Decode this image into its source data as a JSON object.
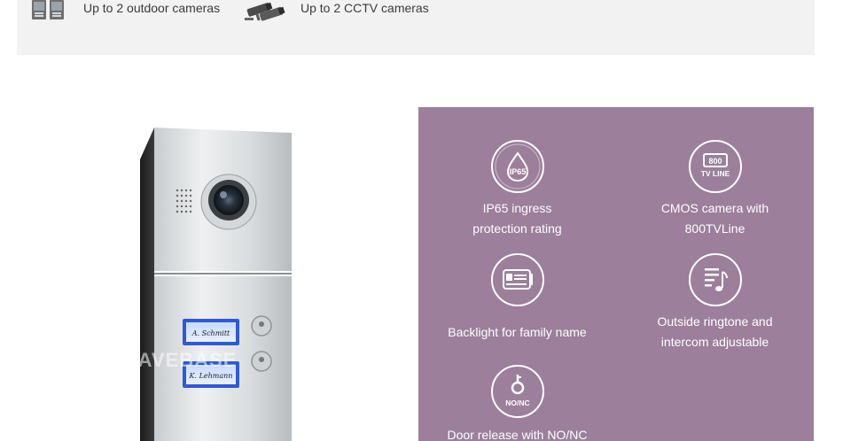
{
  "top_row": {
    "items": [
      {
        "label": "Up to 2 outdoor cameras",
        "icon": "outdoor-camera-icon"
      },
      {
        "label": "Up to 2 CCTV cameras",
        "icon": "cctv-camera-icon"
      }
    ]
  },
  "product": {
    "name_tags": [
      "A. Schmitt",
      "K. Lehmann"
    ],
    "watermark": "SAVEBASE"
  },
  "features": [
    {
      "icon": "ip65-icon",
      "icon_text": "IP65",
      "lines": [
        "IP65 ingress",
        "protection rating"
      ]
    },
    {
      "icon": "tv-line-icon",
      "icon_text": "800",
      "icon_sub": "TV LINE",
      "lines": [
        "CMOS camera with",
        "800TVLine"
      ]
    },
    {
      "icon": "name-card-icon",
      "lines": [
        "Backlight for family name"
      ]
    },
    {
      "icon": "ringtone-icon",
      "lines": [
        "Outside ringtone and",
        "intercom adjustable"
      ]
    },
    {
      "icon": "door-release-icon",
      "icon_sub": "NO/NC",
      "lines": [
        "Door release with NO/NC"
      ]
    }
  ],
  "colors": {
    "panel": "#9b7f9b",
    "band": "#f2f2f2",
    "text": "#3a3a3a"
  }
}
